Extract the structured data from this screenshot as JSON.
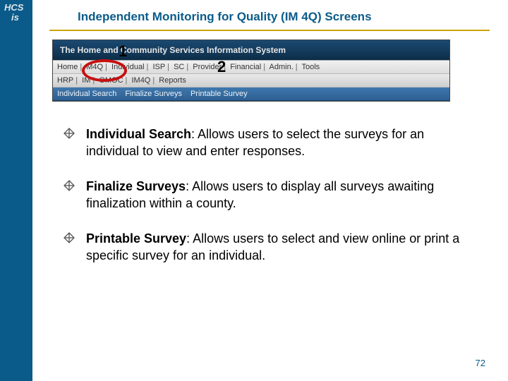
{
  "logo": {
    "line1": "HCS",
    "line2": "is"
  },
  "title": "Independent Monitoring for Quality (IM 4Q) Screens",
  "banner_text": "The Home and Community Services Information System",
  "nav_row1": [
    "Home",
    "M4Q",
    "Individual",
    "ISP",
    "SC",
    "Provider",
    "Financial",
    "Admin.",
    "Tools"
  ],
  "nav_row2": [
    "HRP",
    "IM",
    "OMOC",
    "IM4Q",
    "Reports"
  ],
  "nav_row3": [
    "Individual Search",
    "Finalize Surveys",
    "Printable Survey"
  ],
  "callouts": {
    "one": "1",
    "two": "2"
  },
  "bullets": [
    {
      "lead": "Individual Search",
      "rest": ": Allows users to select the surveys for an individual to view and enter responses."
    },
    {
      "lead": "Finalize Surveys",
      "rest": ": Allows users to display all surveys awaiting finalization within a county."
    },
    {
      "lead": "Printable Survey",
      "rest": ": Allows users to select and view online or print a specific survey for an individual."
    }
  ],
  "page_number": "72"
}
